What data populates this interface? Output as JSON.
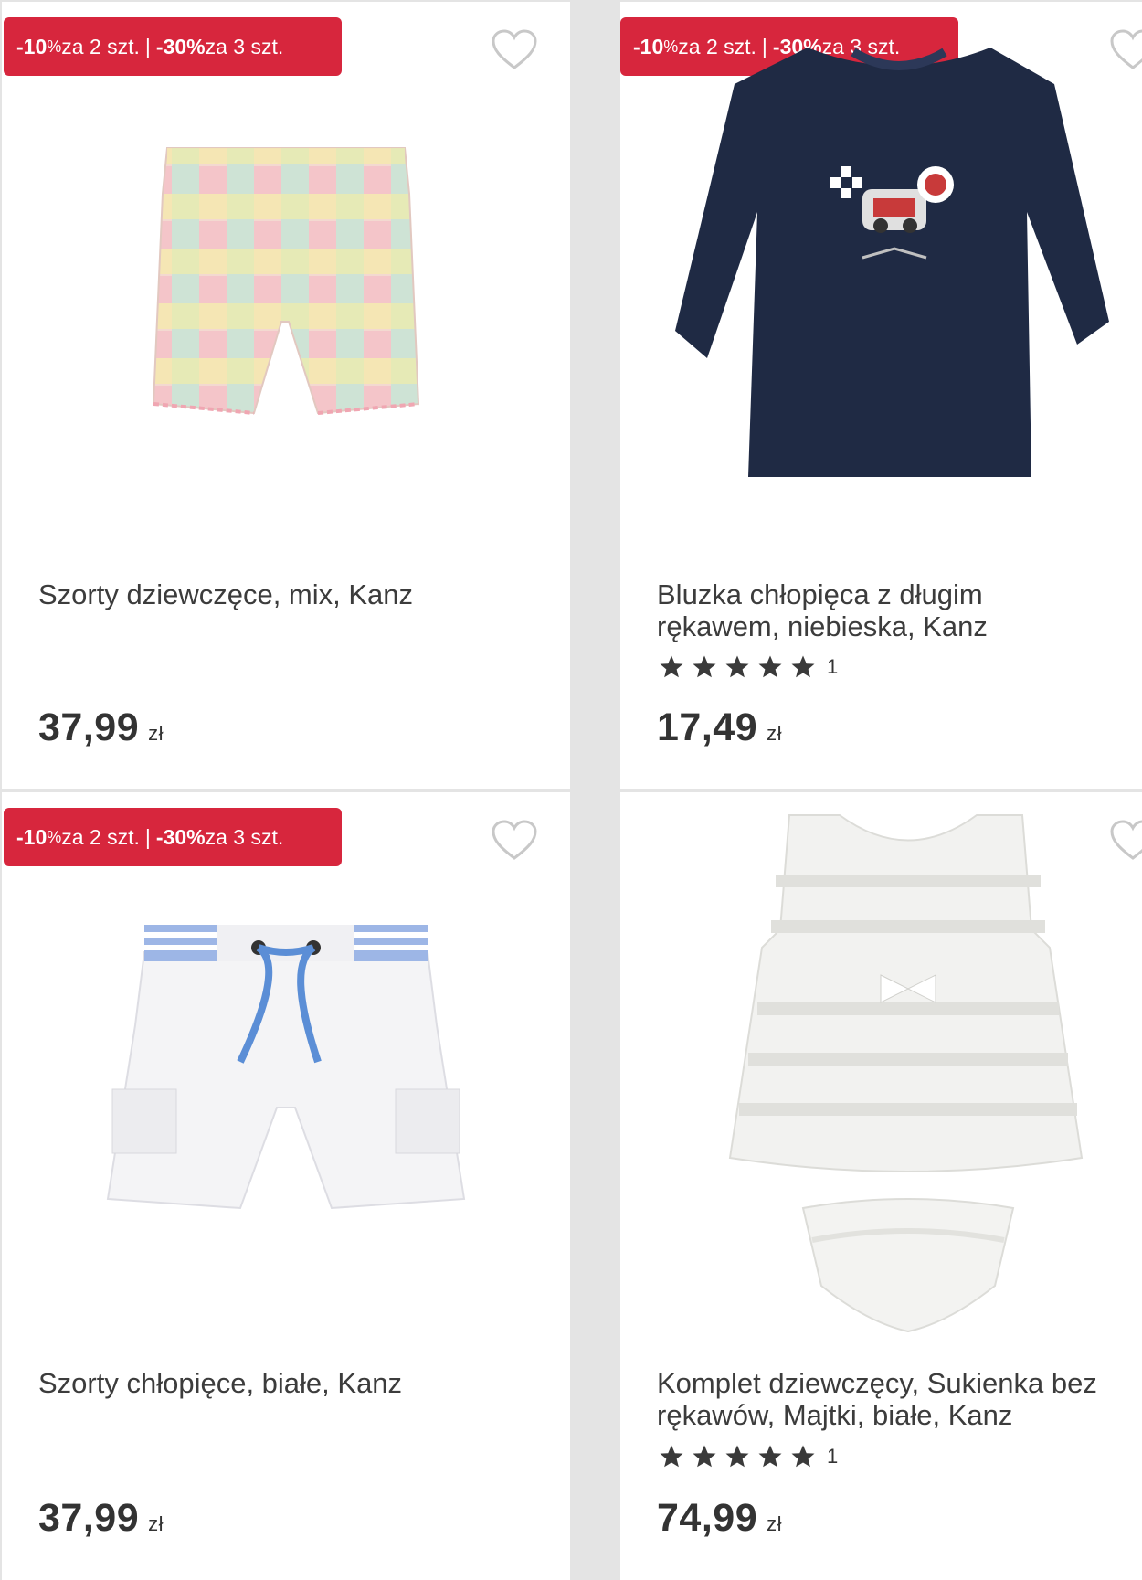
{
  "products": [
    {
      "badge": {
        "pct1": "-10",
        "unit1": "%",
        "txt1": " za 2 szt.",
        "sep": "|",
        "pct2": "-30%",
        "txt2": " za 3 szt."
      },
      "title_line1": "Szorty dziewczęce, mix, Kanz",
      "title_line2": "",
      "rating": null,
      "price": "37,99",
      "currency": "zł",
      "icon": "heart-outline-icon"
    },
    {
      "badge": {
        "pct1": "-10",
        "unit1": "%",
        "txt1": " za 2 szt.",
        "sep": "|",
        "pct2": "-30%",
        "txt2": " za 3 szt."
      },
      "title_line1": "Bluzka chłopięca z długim",
      "title_line2": "rękawem, niebieska, Kanz",
      "rating": {
        "stars": 5,
        "count": "1"
      },
      "price": "17,49",
      "currency": "zł",
      "icon": "heart-outline-icon"
    },
    {
      "badge": {
        "pct1": "-10",
        "unit1": "%",
        "txt1": " za 2 szt.",
        "sep": "|",
        "pct2": "-30%",
        "txt2": " za 3 szt."
      },
      "title_line1": "Szorty chłopięce, białe, Kanz",
      "title_line2": "",
      "rating": null,
      "price": "37,99",
      "currency": "zł",
      "icon": "heart-outline-icon"
    },
    {
      "badge": null,
      "title_line1": "Komplet dziewczęcy, Sukienka bez",
      "title_line2": "rękawów, Majtki, białe, Kanz",
      "rating": {
        "stars": 5,
        "count": "1"
      },
      "price": "74,99",
      "currency": "zł",
      "icon": "heart-outline-icon"
    }
  ],
  "colors": {
    "badge_bg": "#d7263d",
    "background": "#e4e4e4",
    "card": "#ffffff",
    "star": "#3a3a3a"
  }
}
